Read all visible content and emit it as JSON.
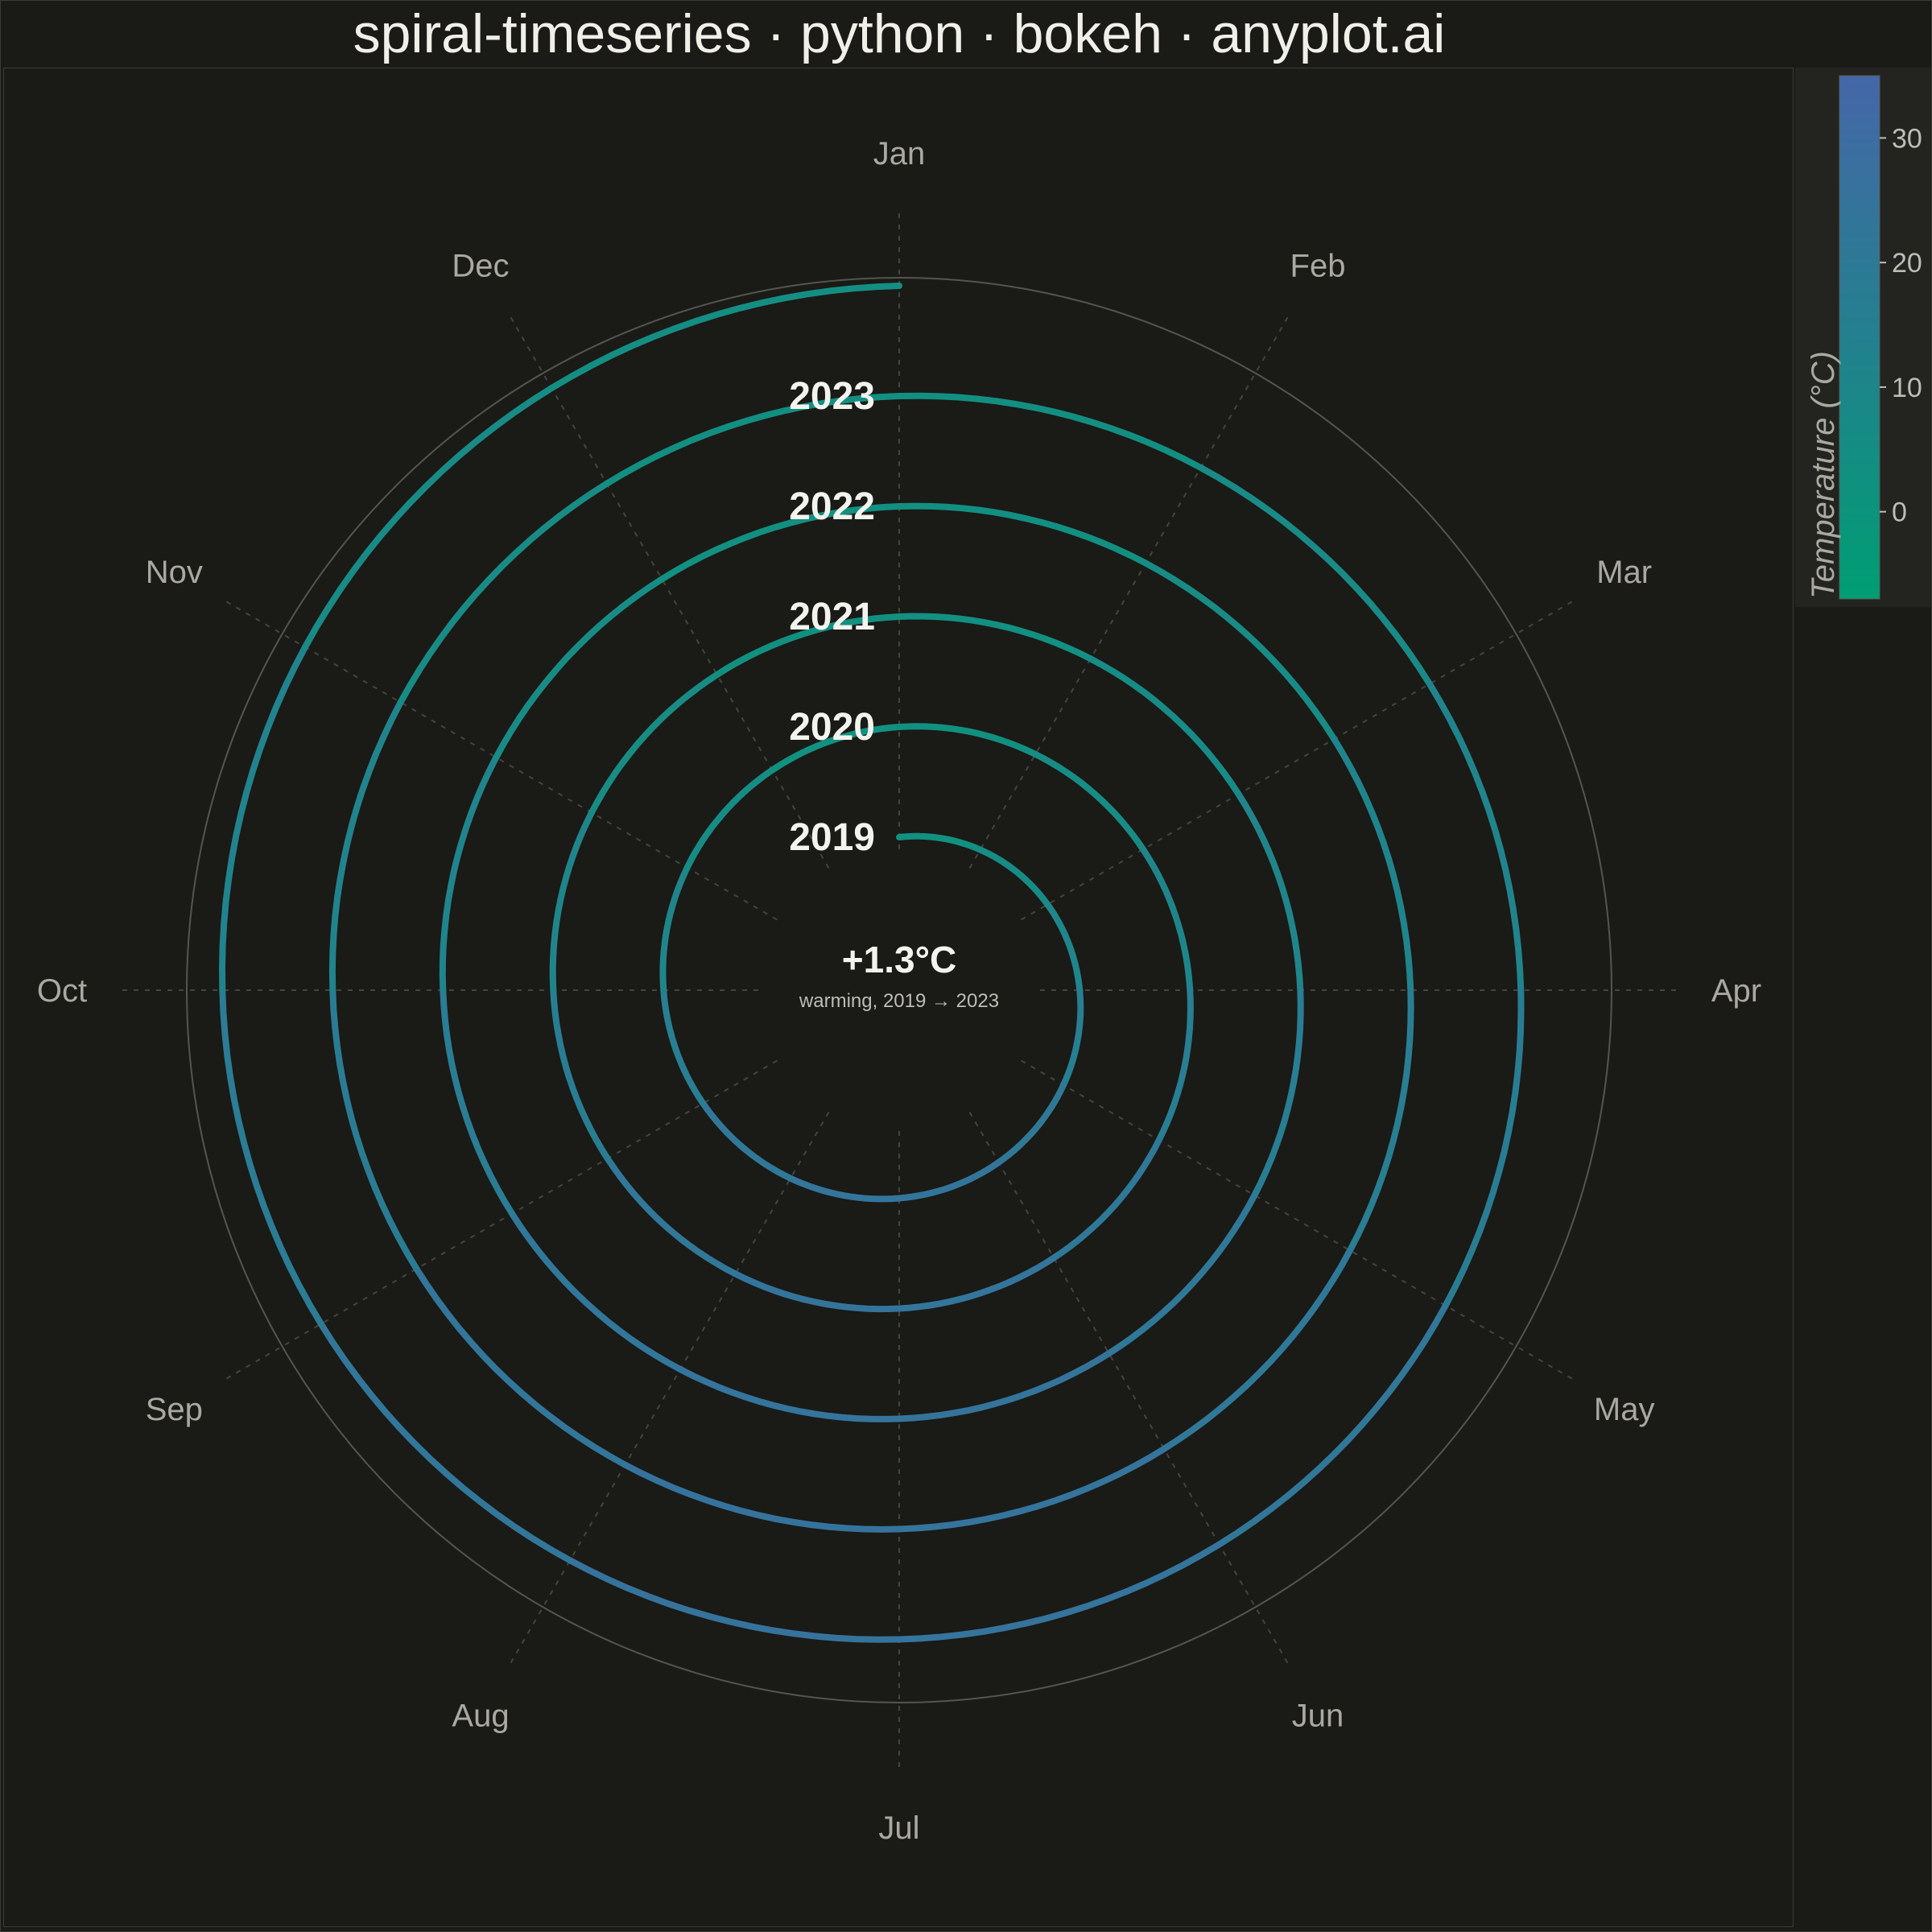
{
  "title": "spiral-timeseries · python · bokeh · anyplot.ai",
  "center": {
    "value": "+1.3°C",
    "caption": "warming, 2019 → 2023"
  },
  "colors": {
    "background": "#1a1a17",
    "grid": "#55554f",
    "low": "#009e73",
    "high": "#4567a8"
  },
  "chart_data": {
    "type": "line",
    "subtype": "spiral",
    "months": [
      "Jan",
      "Feb",
      "Mar",
      "Apr",
      "May",
      "Jun",
      "Jul",
      "Aug",
      "Sep",
      "Oct",
      "Nov",
      "Dec"
    ],
    "years": [
      "2019",
      "2020",
      "2021",
      "2022",
      "2023"
    ],
    "series": [
      {
        "year": "2019",
        "values": [
          2.0,
          4.4,
          9.0,
          14.4,
          19.4,
          23.3,
          25.0,
          24.0,
          20.5,
          15.0,
          9.0,
          4.0
        ]
      },
      {
        "year": "2020",
        "values": [
          2.3,
          4.7,
          9.3,
          14.7,
          19.7,
          23.6,
          25.3,
          24.3,
          20.8,
          15.3,
          9.3,
          4.3
        ]
      },
      {
        "year": "2021",
        "values": [
          2.7,
          5.0,
          9.6,
          15.0,
          20.0,
          24.0,
          25.6,
          24.6,
          21.1,
          15.6,
          9.6,
          4.6
        ]
      },
      {
        "year": "2022",
        "values": [
          3.0,
          5.4,
          9.9,
          15.3,
          20.3,
          24.3,
          26.0,
          25.0,
          21.5,
          16.0,
          10.0,
          5.0
        ]
      },
      {
        "year": "2023",
        "values": [
          3.3,
          5.7,
          10.3,
          15.7,
          20.7,
          24.6,
          26.3,
          25.3,
          21.8,
          16.3,
          10.3,
          5.3
        ]
      }
    ],
    "colorbar": {
      "title": "Temperature (°C)",
      "ticks": [
        0,
        10,
        20,
        30
      ],
      "range": [
        -7,
        35
      ]
    },
    "grid": true
  }
}
